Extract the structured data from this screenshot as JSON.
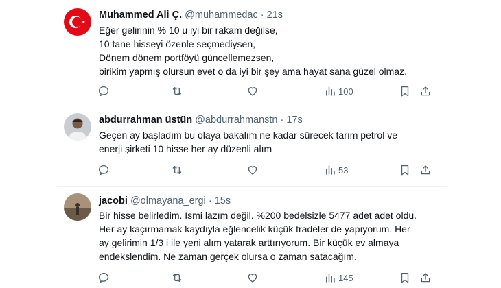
{
  "tweets": [
    {
      "name": "Muhammed Ali Ç.",
      "handle": "@muhammedac",
      "separator": "·",
      "time": "21s",
      "lines": [
        "Eğer gelirinin % 10 u iyi bir rakam değilse,",
        "10 tane hisseyi özenle seçmediysen,",
        "Dönem dönem portföyü güncellemezsen,",
        "birikim yapmış olursun evet o da iyi bir şey ama hayat sana güzel olmaz."
      ],
      "views": "100",
      "avatar_icon": "turkish-flag"
    },
    {
      "name": "abdurrahman üstün",
      "handle": "@abdurrahmanstn",
      "separator": "·",
      "time": "17s",
      "lines": [
        "Geçen ay başladım bu olaya bakalım ne kadar sürecek tarım petrol ve",
        "enerji şirketi 10 hisse her ay düzenli alım"
      ],
      "views": "53",
      "avatar_icon": "user-photo"
    },
    {
      "name": "jacobi",
      "handle": "@olmayana_ergi",
      "separator": "·",
      "time": "15s",
      "lines": [
        "Bir hisse belirledim. İsmi lazım değil. %200 bedelsizle 5477 adet adet oldu.",
        "Her ay kaçırmamak kaydıyla eğlencelik küçük tradeler de yapıyorum. Her",
        "ay gelirimin 1/3 i ile yeni alım yatarak arttırıyorum. Bir küçük ev almaya",
        "endekslendim. Ne zaman gerçek olursa o zaman satacağım."
      ],
      "views": "145",
      "avatar_icon": "user-photo"
    }
  ],
  "colors": {
    "text": "#0f1419",
    "secondary": "#536471",
    "divider": "#eff3f4",
    "flag_red": "#e30a17"
  },
  "icons": [
    "reply-icon",
    "retweet-icon",
    "like-icon",
    "views-icon",
    "bookmark-icon",
    "share-icon"
  ]
}
